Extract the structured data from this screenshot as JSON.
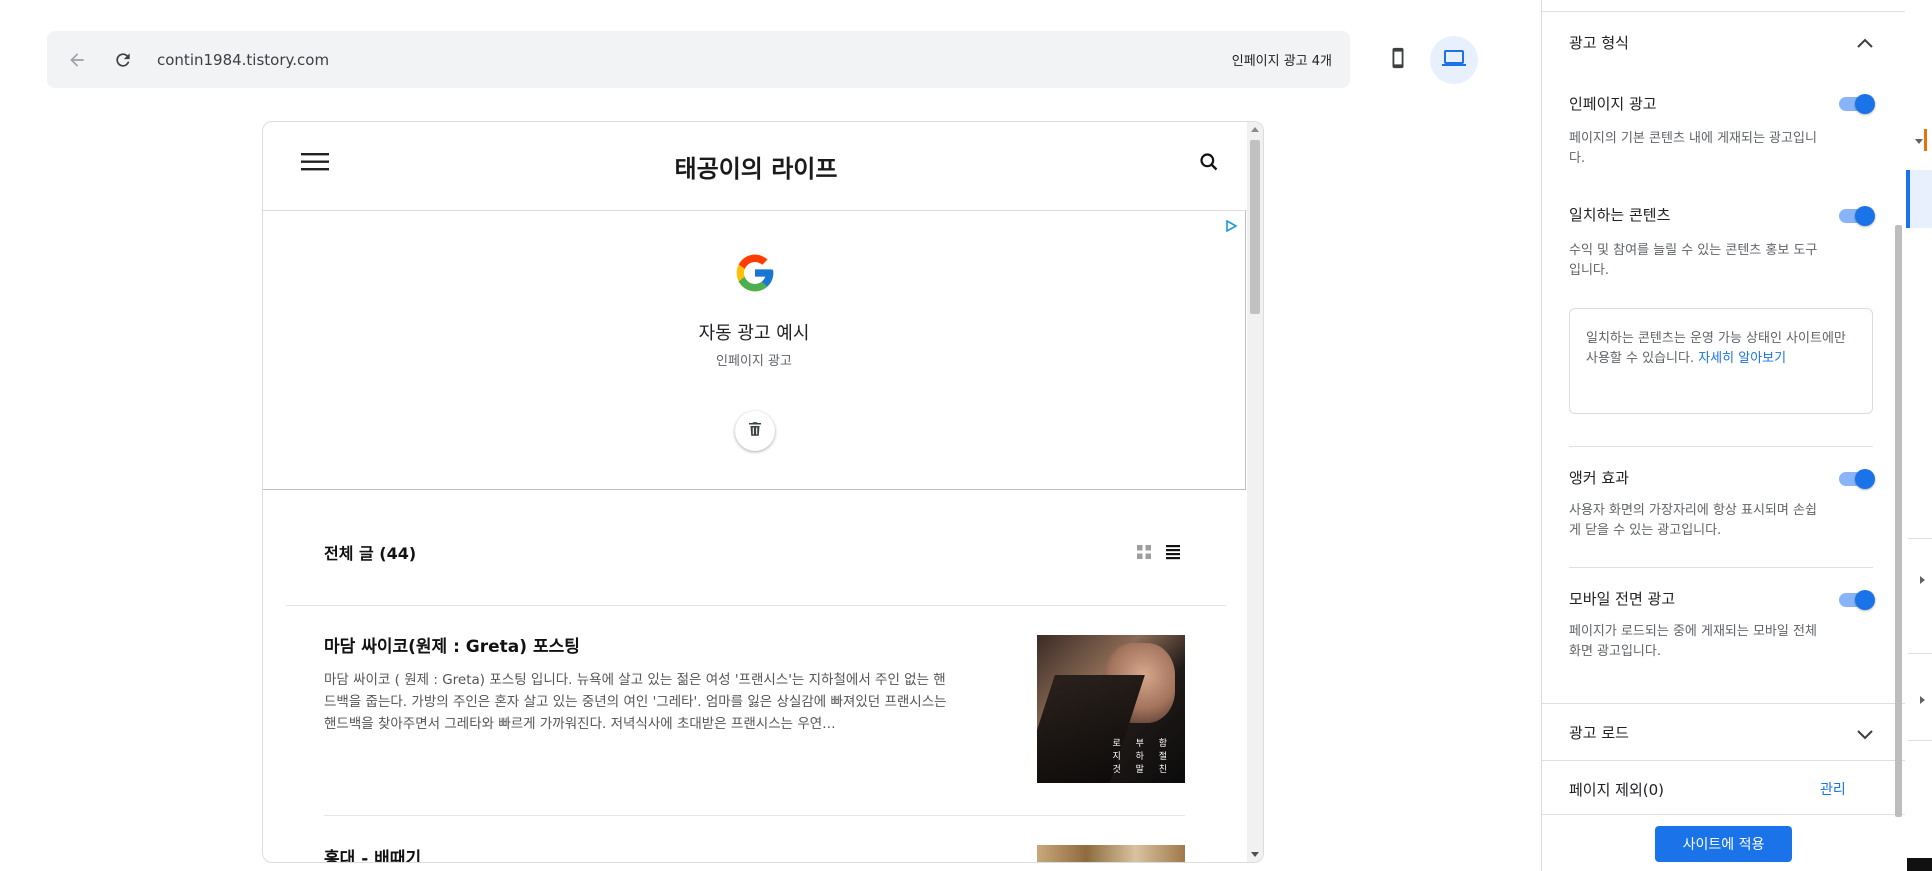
{
  "browser": {
    "url": "contin1984.tistory.com",
    "ad_count_label": "인페이지 광고 4개"
  },
  "preview": {
    "blog_title": "태공이의 라이프",
    "ad_sample": {
      "title": "자동 광고 예시",
      "subtitle": "인페이지 광고"
    },
    "list_heading": "전체 글 (44)",
    "posts": [
      {
        "title": "마담 싸이코(원제 : Greta) 포스팅",
        "excerpt": "마담 싸이코 ( 원제 : Greta) 포스팅 입니다. 뉴욕에 살고 있는 젊은 여성 '프랜시스'는 지하철에서 주인 없는 핸드백을 줍는다. 가방의 주인은 혼자 살고 있는 중년의 여인 '그레타'. 엄마를 잃은 상실감에 빠져있던 프랜시스는 핸드백을 찾아주면서 그레타와 빠르게 가까워진다. 저녁식사에 초대받은 프랜시스는 우연…",
        "thumb_text": "로 부 함 지 하 절 것 말 친"
      },
      {
        "title": "홍대 - 배때기"
      }
    ]
  },
  "panel": {
    "ad_format_heading": "광고 형식",
    "options": [
      {
        "title": "인페이지 광고",
        "desc": "페이지의 기본 콘텐츠 내에 게재되는 광고입니다.",
        "enabled": true
      },
      {
        "title": "일치하는 콘텐츠",
        "desc": "수익 및 참여를 늘릴 수 있는 콘텐츠 홍보 도구입니다.",
        "enabled": true
      },
      {
        "title": "앵커 효과",
        "desc": "사용자 화면의 가장자리에 항상 표시되며 손쉽게 닫을 수 있는 광고입니다.",
        "enabled": true
      },
      {
        "title": "모바일 전면 광고",
        "desc": "페이지가 로드되는 중에 게재되는 모바일 전체 화면 광고입니다.",
        "enabled": true
      }
    ],
    "matched_content_note": "일치하는 콘텐츠는 운영 가능 상태인 사이트에만 사용할 수 있습니다.",
    "learn_more": "자세히 알아보기",
    "ad_load_heading": "광고 로드",
    "page_exclusion": "페이지 제외(0)",
    "manage_label": "관리",
    "apply_button": "사이트에 적용"
  },
  "colors": {
    "accent": "#1a73e8",
    "toggle_track": "#8ab4f8",
    "toolbar_bg": "#f1f3f4"
  }
}
